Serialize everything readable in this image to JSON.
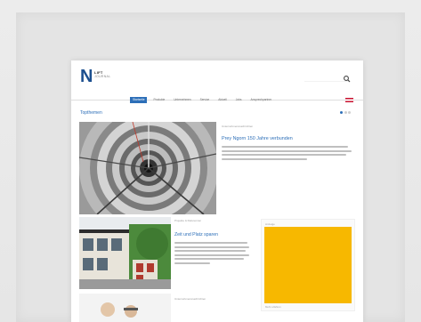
{
  "site": {
    "logo_letter": "N",
    "logo_name": "LIFT",
    "logo_sub": "JOURNAL"
  },
  "nav": {
    "items": [
      "Startseite",
      "Produkte",
      "Unternehmen",
      "Service",
      "Aktuell",
      "Jobs",
      "Ansprechpartner"
    ]
  },
  "section_title": "Topthemen",
  "hero": {
    "tag": "Unternehmensnachrichten",
    "title": "Prey Ngorn 150 Jahre verbunden"
  },
  "card2": {
    "tag": "Projekte & Referenzen",
    "title": "Zeit und Platz sparen"
  },
  "ad": {
    "label": "Anzeige",
    "foot": "Mehr erfahren"
  },
  "card3": {
    "tag": "Unternehmensnachrichten"
  },
  "icons": {
    "search": "search-icon",
    "flag": "flag-icon"
  },
  "colors": {
    "accent": "#2d6fb8",
    "logo": "#1c4f8f",
    "ad": "#f7b800",
    "background": "#e9e9e9"
  }
}
